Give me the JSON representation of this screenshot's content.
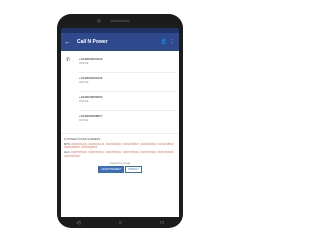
{
  "app_bar": {
    "title": "Call N Power",
    "back_icon": "arrow-back-icon",
    "actions": [
      "add-contact-icon",
      "more-vert-icon"
    ]
  },
  "contacts": [
    {
      "number": "+2349060000449",
      "type": "OFFICE"
    },
    {
      "number": "+2349060000446",
      "type": "OFFICE"
    },
    {
      "number": "+2349039059960",
      "type": "OFFICE"
    },
    {
      "number": "+2349090098827",
      "type": "OFFICE"
    }
  ],
  "forbidden_section": {
    "heading": "N-POWER PHONE NUMBERS",
    "mtn_label": "MTN:",
    "mtn_numbers": "09060000449, 09060000446, 09039059960, 09090098827, 09090098828, 09090098829, 09090098830, 09090098831",
    "glo_label": "GLO:",
    "glo_numbers": "09087865990, 09087865991, 09087865992, 09087865993, 09087865994, 09087865995, 09087865996"
  },
  "footer": {
    "note": "powered by Google",
    "tabs": [
      "ADVERTISEMENT",
      "PRIVACY"
    ]
  },
  "colors": {
    "app_bar": "#2f4a8c",
    "status_bar": "#1f3366",
    "accent_text": "#f26d5b",
    "tab_accent": "#3a6fb6"
  }
}
